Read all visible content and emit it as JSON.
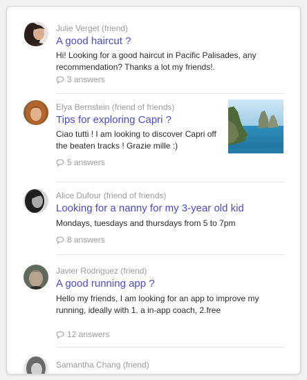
{
  "posts": [
    {
      "author": "Julie Verget (friend)",
      "title": "A good haircut ?",
      "body": "Hi! Looking for a good haircut in Pacific Palisades, any recommendation? Thanks a lot my friends!.",
      "answers": "3 answers"
    },
    {
      "author": "Elya Bernstein (friend of friends)",
      "title": "Tips for exploring Capri ?",
      "body": "Ciao tutti ! I am looking to discover Capri off the beaten tracks ! Grazie mille :)",
      "answers": "5 answers"
    },
    {
      "author": "Alice Dufour (friend of friends)",
      "title": "Looking for a nanny for my 3-year old kid",
      "body": "Mondays, tuesdays and thursdays from 5 to 7pm",
      "answers": "8 answers"
    },
    {
      "author": "Javier Rodriguez (friend)",
      "title": "A good running app ?",
      "body": "Hello my friends, I am looking for an app to improve my running, ideally with 1. a in-app coach, 2.free",
      "answers": "12 answers"
    },
    {
      "author": "Samantha Chang (friend)"
    }
  ],
  "colors": {
    "title": "#4a4acc",
    "meta": "#9b9b9b",
    "body": "#2a2a2a"
  },
  "icons": {
    "answers": "speech-bubble-icon"
  }
}
